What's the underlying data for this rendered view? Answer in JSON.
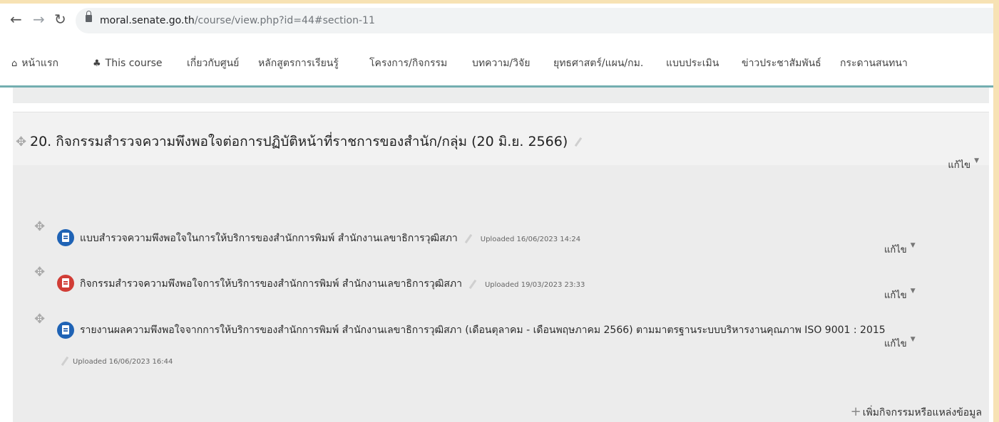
{
  "browser": {
    "url_host": "moral.senate.go.th",
    "url_path": "/course/view.php?id=44#section-11"
  },
  "menu": {
    "items": [
      {
        "label": "หน้าแรก",
        "icon": "home-icon"
      },
      {
        "label": "This course",
        "icon": "sitemap-icon"
      },
      {
        "label": "เกี่ยวกับศูนย์"
      },
      {
        "label": "หลักสูตรการเรียนรู้"
      },
      {
        "label": "โครงการ/กิจกรรม"
      },
      {
        "label": "บทความ/วิจัย"
      },
      {
        "label": "ยุทธศาสตร์/แผน/กม."
      },
      {
        "label": "แบบประเมิน"
      },
      {
        "label": "ข่าวประชาสัมพันธ์"
      },
      {
        "label": "กระดานสนทนา"
      }
    ]
  },
  "section": {
    "title": "20. กิจกรรมสำรวจความพึงพอใจต่อการปฏิบัติหน้าที่ราชการของสำนัก/กลุ่ม (20 มิ.ย. 2566)",
    "edit_label": "แก้ไข",
    "activities": [
      {
        "name": "แบบสำรวจความพึงพอใจในการให้บริการของสำนักการพิมพ์ สำนักงานเลขาธิการวุฒิสภา",
        "uploaded": "Uploaded 16/06/2023 14:24",
        "type": "doc",
        "color": "#1f63b5"
      },
      {
        "name": "กิจกรรมสำรวจความพึงพอใจการให้บริการของสำนักการพิมพ์ สำนักงานเลขาธิการวุฒิสภา",
        "uploaded": "Uploaded 19/03/2023 23:33",
        "type": "pdf",
        "color": "#d13d36"
      },
      {
        "name": "รายงานผลความพึงพอใจจากการให้บริการของสำนักการพิมพ์ สำนักงานเลขาธิการวุฒิสภา (เดือนตุลาคม - เดือนพฤษภาคม 2566) ตามมาตรฐานระบบบริหารงานคุณภาพ ISO 9001 : 2015",
        "uploaded": "Uploaded 16/06/2023 16:44",
        "type": "doc",
        "color": "#1f63b5"
      }
    ],
    "add_label": "เพิ่มกิจกรรมหรือแหล่งข้อมูล"
  }
}
